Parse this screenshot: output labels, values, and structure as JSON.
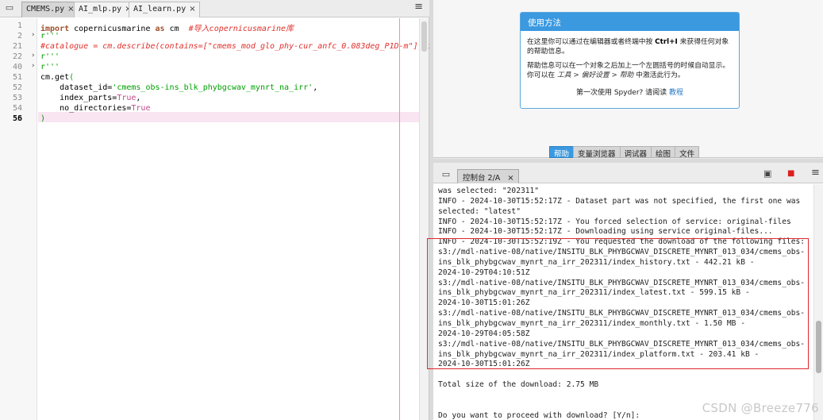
{
  "editor": {
    "tabs": [
      {
        "label": "CMEMS.py",
        "active": true
      },
      {
        "label": "AI_mlp.py",
        "active": false
      },
      {
        "label": "AI_learn.py",
        "active": false
      }
    ],
    "close_glyph": "×",
    "menu_glyph": "≡",
    "lines": [
      {
        "num": "1",
        "fold": "",
        "current": false
      },
      {
        "num": "2",
        "fold": "›",
        "current": false
      },
      {
        "num": "21",
        "fold": "",
        "current": false
      },
      {
        "num": "22",
        "fold": "›",
        "current": false
      },
      {
        "num": "40",
        "fold": "›",
        "current": false
      },
      {
        "num": "51",
        "fold": "",
        "current": false
      },
      {
        "num": "52",
        "fold": "",
        "current": false
      },
      {
        "num": "53",
        "fold": "",
        "current": false
      },
      {
        "num": "54",
        "fold": "",
        "current": false
      },
      {
        "num": "55",
        "fold": "",
        "current": false
      },
      {
        "num": "56",
        "fold": "",
        "current": true
      }
    ],
    "code": {
      "l1_kw": "import",
      "l1_mod": " copernicusmarine ",
      "l1_as": "as",
      "l1_alias": " cm  ",
      "l1_comment": "#导入copernicusmarine库",
      "l2": "r'''",
      "l3": "#catalogue = cm.describe(contains=[\"cmems_mod_glo_phy-cur_anfc_0.083deg_P1D-m\"], inc",
      "l4": "r'''",
      "l5": "r'''",
      "l6_obj": "cm.get",
      "l6_paren": "(",
      "l7_key": "    dataset_id=",
      "l7_val": "'cmems_obs-ins_blk_phybgcwav_mynrt_na_irr'",
      "l7_end": ",",
      "l8_key": "    index_parts=",
      "l8_val": "True",
      "l8_end": ",",
      "l9_key": "    no_directories=",
      "l9_val": "True",
      "l10": ")"
    }
  },
  "help": {
    "title": "使用方法",
    "para1_a": "在这里你可以通过在编辑器或者终端中按 ",
    "para1_key": "Ctrl+I",
    "para1_b": " 来获得任何对象的帮助信息。",
    "para2_a": "帮助信息可以在一个对象之后加上一个左圆括号的时候自动显示。 你可以在 ",
    "para2_path": "工具 > 偏好设置 > 帮助",
    "para2_b": " 中激活此行为。",
    "tutorial_a": "第一次使用 Spyder? 请阅读 ",
    "tutorial_link": "教程",
    "tabs": [
      "帮助",
      "变量浏览器",
      "调试器",
      "绘图",
      "文件"
    ]
  },
  "console": {
    "tab_label": "控制台 2/A",
    "close_glyph": "×",
    "lines": [
      "was selected: \"202311\"",
      "INFO - 2024-10-30T15:52:17Z - Dataset part was not specified, the first one was",
      "selected: \"latest\"",
      "INFO - 2024-10-30T15:52:17Z - You forced selection of service: original-files",
      "INFO - 2024-10-30T15:52:17Z - Downloading using service original-files...",
      "INFO - 2024-10-30T15:52:19Z - You requested the download of the following files:",
      "s3://mdl-native-08/native/INSITU_BLK_PHYBGCWAV_DISCRETE_MYNRT_013_034/cmems_obs-",
      "ins_blk_phybgcwav_mynrt_na_irr_202311/index_history.txt - 442.21 kB -",
      "2024-10-29T04:10:51Z",
      "s3://mdl-native-08/native/INSITU_BLK_PHYBGCWAV_DISCRETE_MYNRT_013_034/cmems_obs-",
      "ins_blk_phybgcwav_mynrt_na_irr_202311/index_latest.txt - 599.15 kB -",
      "2024-10-30T15:01:26Z",
      "s3://mdl-native-08/native/INSITU_BLK_PHYBGCWAV_DISCRETE_MYNRT_013_034/cmems_obs-",
      "ins_blk_phybgcwav_mynrt_na_irr_202311/index_monthly.txt - 1.50 MB -",
      "2024-10-29T04:05:58Z",
      "s3://mdl-native-08/native/INSITU_BLK_PHYBGCWAV_DISCRETE_MYNRT_013_034/cmems_obs-",
      "ins_blk_phybgcwav_mynrt_na_irr_202311/index_platform.txt - 203.41 kB -",
      "2024-10-30T15:01:26Z",
      "",
      "Total size of the download: 2.75 MB",
      "",
      "",
      "Do you want to proceed with download? [Y/n]:"
    ]
  },
  "watermark": "CSDN @Breeze776",
  "colors": {
    "accent": "#3b99e0",
    "highlight_box": "#e0262c",
    "keyword": "#a0522d",
    "comment": "#e0302c",
    "string": "#00a000"
  }
}
